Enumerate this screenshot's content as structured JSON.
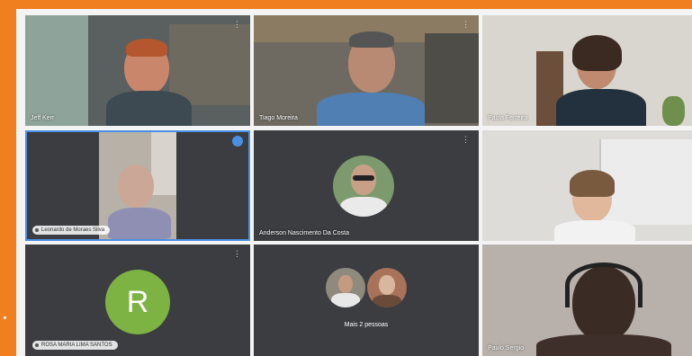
{
  "meeting": {
    "participants": [
      {
        "id": "p1",
        "name": "Jeff Kerr"
      },
      {
        "id": "p2",
        "name": "Tiago Moreira"
      },
      {
        "id": "p3",
        "name": "Paula Ferreira"
      },
      {
        "id": "p4",
        "name": "Leonardo de Moraes Silva"
      },
      {
        "id": "p5",
        "name": "Anderson Nascimento Da Costa"
      },
      {
        "id": "p6",
        "name": ""
      },
      {
        "id": "p7",
        "name": "ROSA MARIA LIMA SANTOS",
        "initial": "R"
      },
      {
        "id": "p8",
        "name": "Mais 2 pessoas"
      },
      {
        "id": "p9",
        "name": "Paulo Sergio"
      }
    ]
  },
  "colors": {
    "frame": "#ef7f1f",
    "tile": "#3b3d40",
    "active_border": "#4a90e2",
    "avatar_green": "#7cb342"
  }
}
